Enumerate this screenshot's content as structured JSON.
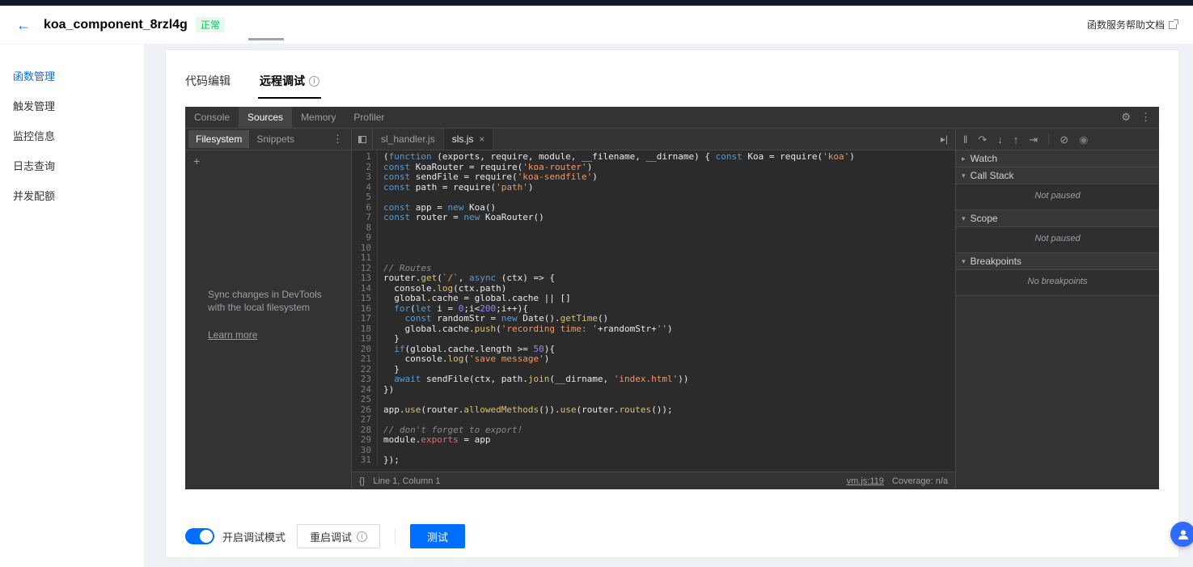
{
  "header": {
    "back_icon": "←",
    "title": "koa_component_8rzl4g",
    "status_badge": "正常",
    "help_link": "函数服务帮助文档"
  },
  "icons": {
    "info": "i",
    "gear": "⚙",
    "kebab": "⋮",
    "close": "×",
    "plus": "+",
    "pretty_print": "{}",
    "caret_right": "▸",
    "caret_down": "▾",
    "pause": "‖",
    "step_over": "↷",
    "step_into": "↓",
    "step_out": "↑",
    "step": "⇥",
    "deactivate_breakpoints": "⊘",
    "pause_on_exceptions": "◉",
    "more_tabs": "▸|"
  },
  "sidebar": {
    "items": [
      {
        "label": "函数管理",
        "active": true
      },
      {
        "label": "触发管理",
        "active": false
      },
      {
        "label": "监控信息",
        "active": false
      },
      {
        "label": "日志查询",
        "active": false
      },
      {
        "label": "并发配额",
        "active": false
      }
    ]
  },
  "card": {
    "tabs": [
      {
        "label": "代码编辑",
        "active": false,
        "info": false
      },
      {
        "label": "远程调试",
        "active": true,
        "info": true
      }
    ]
  },
  "devtools": {
    "panel_tabs": [
      {
        "label": "Console",
        "active": false
      },
      {
        "label": "Sources",
        "active": true
      },
      {
        "label": "Memory",
        "active": false
      },
      {
        "label": "Profiler",
        "active": false
      }
    ],
    "left": {
      "tabs": [
        {
          "label": "Filesystem",
          "active": true
        },
        {
          "label": "Snippets",
          "active": false
        }
      ],
      "sync_text_line1": "Sync changes in DevTools",
      "sync_text_line2": "with the local filesystem",
      "learn_more": "Learn more"
    },
    "editor": {
      "file_tabs": [
        {
          "label": "sl_handler.js",
          "active": false,
          "closable": false
        },
        {
          "label": "sls.js",
          "active": true,
          "closable": true
        }
      ],
      "status": {
        "position": "Line 1, Column 1",
        "link": "vm.js:119",
        "coverage": "Coverage: n/a"
      },
      "code_lines": [
        [
          [
            "p",
            "("
          ],
          [
            "k",
            "function"
          ],
          [
            "p",
            " (exports, require, module, __filename, __dirname) { "
          ],
          [
            "k",
            "const"
          ],
          [
            "p",
            " Koa = require("
          ],
          [
            "s",
            "'koa'"
          ],
          [
            "p",
            ")"
          ]
        ],
        [
          [
            "k",
            "const"
          ],
          [
            "p",
            " KoaRouter = require("
          ],
          [
            "s",
            "'koa-router'"
          ],
          [
            "p",
            ")"
          ]
        ],
        [
          [
            "k",
            "const"
          ],
          [
            "p",
            " sendFile = require("
          ],
          [
            "s",
            "'koa-sendfile'"
          ],
          [
            "p",
            ")"
          ]
        ],
        [
          [
            "k",
            "const"
          ],
          [
            "p",
            " path = require("
          ],
          [
            "s",
            "'path'"
          ],
          [
            "p",
            ")"
          ]
        ],
        [],
        [
          [
            "k",
            "const"
          ],
          [
            "p",
            " app = "
          ],
          [
            "k",
            "new"
          ],
          [
            "p",
            " Koa()"
          ]
        ],
        [
          [
            "k",
            "const"
          ],
          [
            "p",
            " router = "
          ],
          [
            "k",
            "new"
          ],
          [
            "p",
            " KoaRouter()"
          ]
        ],
        [],
        [],
        [],
        [],
        [
          [
            "c",
            "// Routes"
          ]
        ],
        [
          [
            "p",
            "router."
          ],
          [
            "f",
            "get"
          ],
          [
            "p",
            "("
          ],
          [
            "s",
            "`/`"
          ],
          [
            "p",
            ", "
          ],
          [
            "k",
            "async"
          ],
          [
            "p",
            " (ctx) => {"
          ]
        ],
        [
          [
            "p",
            "  console."
          ],
          [
            "f",
            "log"
          ],
          [
            "p",
            "(ctx.path)"
          ]
        ],
        [
          [
            "p",
            "  global.cache = global.cache || []"
          ]
        ],
        [
          [
            "p",
            "  "
          ],
          [
            "k",
            "for"
          ],
          [
            "p",
            "("
          ],
          [
            "k",
            "let"
          ],
          [
            "p",
            " i = "
          ],
          [
            "n",
            "0"
          ],
          [
            "p",
            ";i<"
          ],
          [
            "n",
            "200"
          ],
          [
            "p",
            ";i++){"
          ]
        ],
        [
          [
            "p",
            "    "
          ],
          [
            "k",
            "const"
          ],
          [
            "p",
            " randomStr = "
          ],
          [
            "k",
            "new"
          ],
          [
            "p",
            " Date()."
          ],
          [
            "f",
            "getTime"
          ],
          [
            "p",
            "()"
          ]
        ],
        [
          [
            "p",
            "    global.cache."
          ],
          [
            "f",
            "push"
          ],
          [
            "p",
            "("
          ],
          [
            "s",
            "'recording time: '"
          ],
          [
            "p",
            "+randomStr+"
          ],
          [
            "s",
            "''"
          ],
          [
            "p",
            ")"
          ]
        ],
        [
          [
            "p",
            "  }"
          ]
        ],
        [
          [
            "p",
            "  "
          ],
          [
            "k",
            "if"
          ],
          [
            "p",
            "(global.cache.length >= "
          ],
          [
            "n",
            "50"
          ],
          [
            "p",
            "){"
          ]
        ],
        [
          [
            "p",
            "    console."
          ],
          [
            "f",
            "log"
          ],
          [
            "p",
            "("
          ],
          [
            "s",
            "'save message'"
          ],
          [
            "p",
            ")"
          ]
        ],
        [
          [
            "p",
            "  }"
          ]
        ],
        [
          [
            "p",
            "  "
          ],
          [
            "k",
            "await"
          ],
          [
            "p",
            " sendFile(ctx, path."
          ],
          [
            "f",
            "join"
          ],
          [
            "p",
            "(__dirname, "
          ],
          [
            "s",
            "'index.html'"
          ],
          [
            "p",
            "))"
          ]
        ],
        [
          [
            "p",
            "})"
          ]
        ],
        [],
        [
          [
            "p",
            "app."
          ],
          [
            "f",
            "use"
          ],
          [
            "p",
            "(router."
          ],
          [
            "f",
            "allowedMethods"
          ],
          [
            "p",
            "())."
          ],
          [
            "f",
            "use"
          ],
          [
            "p",
            "(router."
          ],
          [
            "f",
            "routes"
          ],
          [
            "p",
            "());"
          ]
        ],
        [],
        [
          [
            "c",
            "// don't forget to export!"
          ]
        ],
        [
          [
            "p",
            "module."
          ],
          [
            "pr",
            "exports"
          ],
          [
            "p",
            " = app"
          ]
        ],
        [],
        [
          [
            "p",
            "});"
          ]
        ]
      ]
    },
    "debugger": {
      "sections": [
        {
          "label": "Watch",
          "collapsed": true,
          "content": "",
          "italic": false
        },
        {
          "label": "Call Stack",
          "collapsed": false,
          "content": "Not paused",
          "italic": true
        },
        {
          "label": "Scope",
          "collapsed": false,
          "content": "Not paused",
          "italic": true
        },
        {
          "label": "Breakpoints",
          "collapsed": false,
          "content": "No breakpoints",
          "italic": true
        }
      ]
    }
  },
  "footer": {
    "toggle_label": "开启调试模式",
    "restart_label": "重启调试",
    "test_label": "测试"
  },
  "colors": {
    "primary": "#006eff",
    "badge_green": "#0abf5b",
    "devtools_bg": "#333333"
  }
}
